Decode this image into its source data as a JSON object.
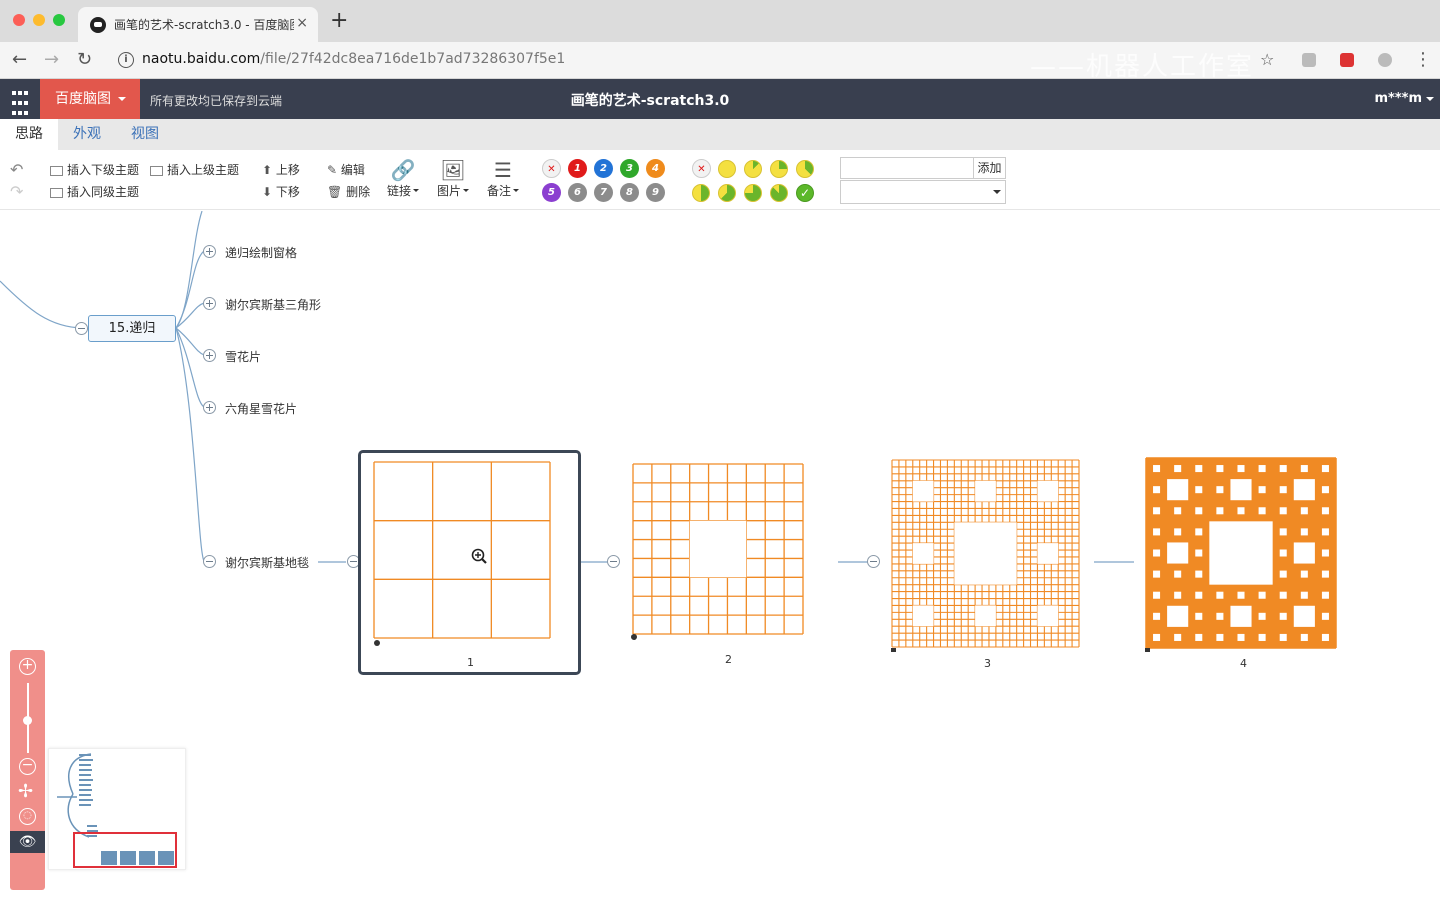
{
  "browser": {
    "tab_title": "画笔的艺术-scratch3.0 - 百度脑图",
    "new_tab": "+",
    "tab_close": "×",
    "url_host": "naotu.baidu.com",
    "url_path": "/file/27f42dc8ea716de1b7ad73286307f5e1",
    "watermark": "——机器人工作室"
  },
  "app": {
    "brand": "百度脑图",
    "save_status": "所有更改均已保存到云端",
    "title": "画笔的艺术-scratch3.0",
    "user": "m***m"
  },
  "ribbon_tabs": [
    "思路",
    "外观",
    "视图"
  ],
  "toolbar": {
    "insert_child": "插入下级主题",
    "insert_parent": "插入上级主题",
    "insert_sibling": "插入同级主题",
    "move_up": "上移",
    "move_down": "下移",
    "edit": "编辑",
    "delete": "删除",
    "link": "链接",
    "image": "图片",
    "note": "备注",
    "resource_add": "添加",
    "priority_numbers": [
      "1",
      "2",
      "3",
      "4",
      "5",
      "6",
      "7",
      "8",
      "9"
    ],
    "priority_colors": [
      "#e01b1b",
      "#2273d6",
      "#2fa82b",
      "#ef8b1c",
      "#8b3fd0",
      "#8c8c8c",
      "#8c8c8c",
      "#8c8c8c",
      "#8c8c8c"
    ]
  },
  "mindmap": {
    "main_node": "15.递归",
    "branches": [
      {
        "label": "递归绘制窗格"
      },
      {
        "label": "谢尔宾斯基三角形"
      },
      {
        "label": "雪花片"
      },
      {
        "label": "六角星雪花片"
      },
      {
        "label": "谢尔宾斯基地毯"
      }
    ],
    "image_captions": [
      "1",
      "2",
      "3",
      "4"
    ],
    "fractal_color": "#f08a24"
  }
}
